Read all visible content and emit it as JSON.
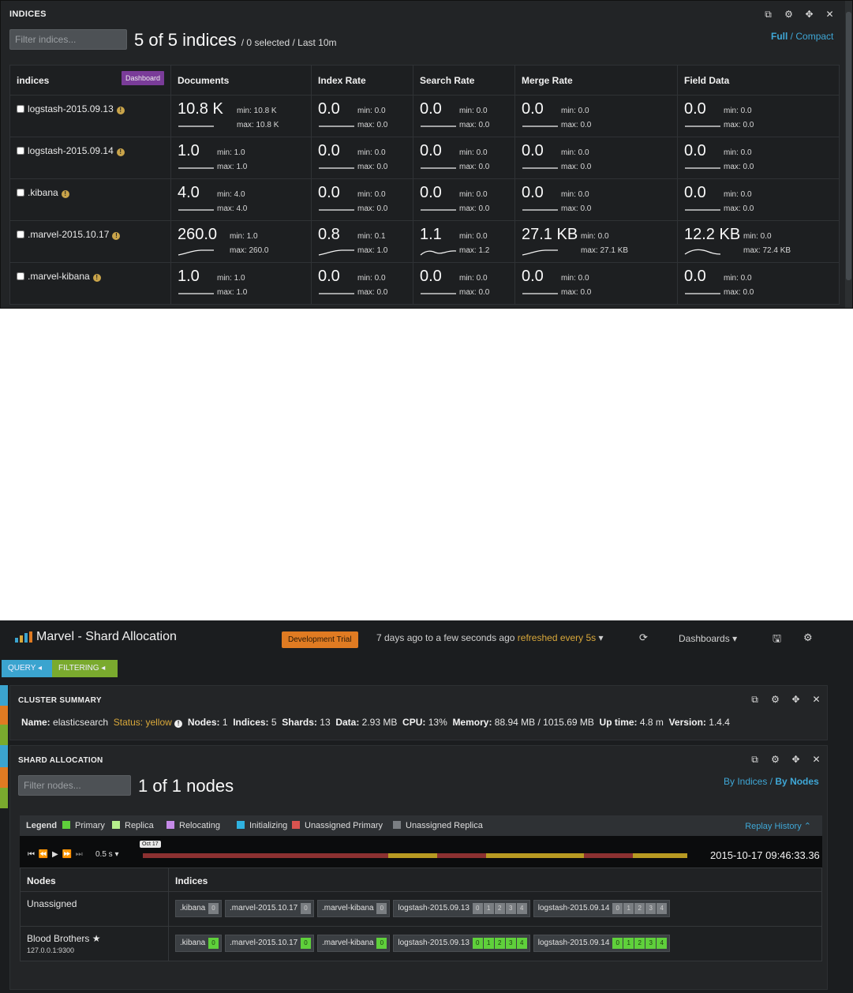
{
  "indices_panel": {
    "title": "INDICES",
    "filter_placeholder": "Filter indices...",
    "count_text": "5 of 5 indices",
    "count_suffix": "/ 0 selected / Last 10m",
    "view_full": "Full",
    "view_sep": "/",
    "view_compact": "Compact",
    "dashboard_label": "Dashboard",
    "columns": [
      "indices",
      "Documents",
      "Index Rate",
      "Search Rate",
      "Merge Rate",
      "Field Data"
    ],
    "rows": [
      {
        "name": "logstash-2015.09.13",
        "metrics": [
          {
            "value": "10.8 K",
            "min": "min: 10.8 K",
            "max": "max: 10.8 K",
            "trend": "flat"
          },
          {
            "value": "0.0",
            "min": "min: 0.0",
            "max": "max: 0.0",
            "trend": "flat"
          },
          {
            "value": "0.0",
            "min": "min: 0.0",
            "max": "max: 0.0",
            "trend": "flat"
          },
          {
            "value": "0.0",
            "min": "min: 0.0",
            "max": "max: 0.0",
            "trend": "flat"
          },
          {
            "value": "0.0",
            "min": "min: 0.0",
            "max": "max: 0.0",
            "trend": "flat"
          }
        ]
      },
      {
        "name": "logstash-2015.09.14",
        "metrics": [
          {
            "value": "1.0",
            "min": "min: 1.0",
            "max": "max: 1.0",
            "trend": "flat"
          },
          {
            "value": "0.0",
            "min": "min: 0.0",
            "max": "max: 0.0",
            "trend": "flat"
          },
          {
            "value": "0.0",
            "min": "min: 0.0",
            "max": "max: 0.0",
            "trend": "flat"
          },
          {
            "value": "0.0",
            "min": "min: 0.0",
            "max": "max: 0.0",
            "trend": "flat"
          },
          {
            "value": "0.0",
            "min": "min: 0.0",
            "max": "max: 0.0",
            "trend": "flat"
          }
        ]
      },
      {
        "name": ".kibana",
        "metrics": [
          {
            "value": "4.0",
            "min": "min: 4.0",
            "max": "max: 4.0",
            "trend": "flat"
          },
          {
            "value": "0.0",
            "min": "min: 0.0",
            "max": "max: 0.0",
            "trend": "flat"
          },
          {
            "value": "0.0",
            "min": "min: 0.0",
            "max": "max: 0.0",
            "trend": "flat"
          },
          {
            "value": "0.0",
            "min": "min: 0.0",
            "max": "max: 0.0",
            "trend": "flat"
          },
          {
            "value": "0.0",
            "min": "min: 0.0",
            "max": "max: 0.0",
            "trend": "flat"
          }
        ]
      },
      {
        "name": ".marvel-2015.10.17",
        "metrics": [
          {
            "value": "260.0",
            "min": "min: 1.0",
            "max": "max: 260.0",
            "trend": "rise"
          },
          {
            "value": "0.8",
            "min": "min: 0.1",
            "max": "max: 1.0",
            "trend": "rise"
          },
          {
            "value": "1.1",
            "min": "min: 0.0",
            "max": "max: 1.2",
            "trend": "wave"
          },
          {
            "value": "27.1 KB",
            "min": "min: 0.0",
            "max": "max: 27.1 KB",
            "trend": "rise"
          },
          {
            "value": "12.2 KB",
            "min": "min: 0.0",
            "max": "max: 72.4 KB",
            "trend": "hump"
          }
        ]
      },
      {
        "name": ".marvel-kibana",
        "metrics": [
          {
            "value": "1.0",
            "min": "min: 1.0",
            "max": "max: 1.0",
            "trend": "flat"
          },
          {
            "value": "0.0",
            "min": "min: 0.0",
            "max": "max: 0.0",
            "trend": "flat"
          },
          {
            "value": "0.0",
            "min": "min: 0.0",
            "max": "max: 0.0",
            "trend": "flat"
          },
          {
            "value": "0.0",
            "min": "min: 0.0",
            "max": "max: 0.0",
            "trend": "flat"
          },
          {
            "value": "0.0",
            "min": "min: 0.0",
            "max": "max: 0.0",
            "trend": "flat"
          }
        ]
      }
    ]
  },
  "marvel": {
    "app_title": "Marvel - Shard Allocation",
    "trial_badge": "Development Trial",
    "time_range": "7 days ago to a few seconds ago",
    "refresh_text": "refreshed every 5s",
    "dashboards_label": "Dashboards",
    "query_pill": "QUERY",
    "filtering_pill": "FILTERING",
    "cluster": {
      "title": "CLUSTER SUMMARY",
      "name_label": "Name:",
      "name_value": "elasticsearch",
      "status_label": "Status:",
      "status_value": "yellow",
      "nodes_label": "Nodes:",
      "nodes_value": "1",
      "indices_label": "Indices:",
      "indices_value": "5",
      "shards_label": "Shards:",
      "shards_value": "13",
      "data_label": "Data:",
      "data_value": "2.93 MB",
      "cpu_label": "CPU:",
      "cpu_value": "13%",
      "memory_label": "Memory:",
      "memory_value": "88.94 MB / 1015.69 MB",
      "uptime_label": "Up time:",
      "uptime_value": "4.8 m",
      "version_label": "Version:",
      "version_value": "1.4.4"
    },
    "shard": {
      "title": "SHARD ALLOCATION",
      "filter_placeholder": "Filter nodes...",
      "count_text": "1 of 1 nodes",
      "by_indices": "By Indices",
      "sep": "/",
      "by_nodes": "By Nodes",
      "legend_title": "Legend",
      "legend": [
        {
          "label": "Primary",
          "color": "#5fd03b"
        },
        {
          "label": "Replica",
          "color": "#b6ef8c"
        },
        {
          "label": "Relocating",
          "color": "#c58ae8"
        },
        {
          "label": "Initializing",
          "color": "#2fb2e0"
        },
        {
          "label": "Unassigned Primary",
          "color": "#d9534f"
        },
        {
          "label": "Unassigned Replica",
          "color": "#7a7e82"
        }
      ],
      "replay_label": "Replay History",
      "speed": "0.5 s",
      "flag": "Oct 17",
      "timestamp": "2015-10-17 09:46:33.36",
      "timeline_segments": [
        {
          "status": "red",
          "color": "#8c3131",
          "fraction": 0.45
        },
        {
          "status": "yellow",
          "color": "#b89a22",
          "fraction": 0.09
        },
        {
          "status": "red",
          "color": "#8c3131",
          "fraction": 0.09
        },
        {
          "status": "yellow",
          "color": "#b89a22",
          "fraction": 0.18
        },
        {
          "status": "red",
          "color": "#8c3131",
          "fraction": 0.09
        },
        {
          "status": "yellow",
          "color": "#b89a22",
          "fraction": 0.1
        }
      ],
      "col_nodes": "Nodes",
      "col_indices": "Indices",
      "rows": [
        {
          "node": "Unassigned",
          "addr": "",
          "state": "un",
          "chips": [
            {
              "name": ".kibana",
              "shards": [
                "0"
              ]
            },
            {
              "name": ".marvel-2015.10.17",
              "shards": [
                "0"
              ]
            },
            {
              "name": ".marvel-kibana",
              "shards": [
                "0"
              ]
            },
            {
              "name": "logstash-2015.09.13",
              "shards": [
                "0",
                "1",
                "2",
                "3",
                "4"
              ]
            },
            {
              "name": "logstash-2015.09.14",
              "shards": [
                "0",
                "1",
                "2",
                "3",
                "4"
              ]
            }
          ]
        },
        {
          "node": "Blood Brothers",
          "addr": "127.0.0.1:9300",
          "state": "pr",
          "chips": [
            {
              "name": ".kibana",
              "shards": [
                "0"
              ]
            },
            {
              "name": ".marvel-2015.10.17",
              "shards": [
                "0"
              ]
            },
            {
              "name": ".marvel-kibana",
              "shards": [
                "0"
              ]
            },
            {
              "name": "logstash-2015.09.13",
              "shards": [
                "0",
                "1",
                "2",
                "3",
                "4"
              ]
            },
            {
              "name": "logstash-2015.09.14",
              "shards": [
                "0",
                "1",
                "2",
                "3",
                "4"
              ]
            }
          ]
        }
      ]
    }
  }
}
